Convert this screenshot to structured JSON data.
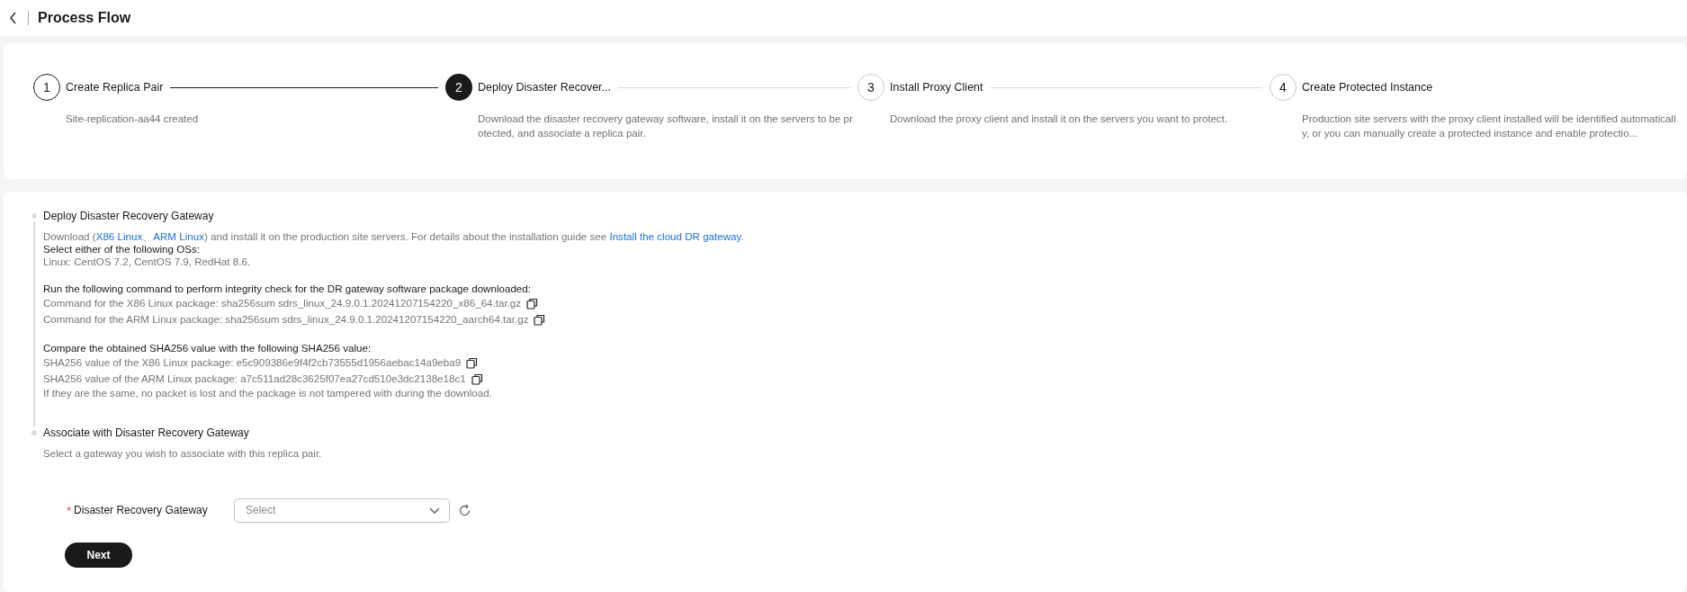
{
  "header": {
    "title": "Process Flow"
  },
  "steps": [
    {
      "number": "1",
      "title": "Create Replica Pair",
      "description": "Site-replication-aa44 created",
      "completed": true,
      "current": false
    },
    {
      "number": "2",
      "title": "Deploy Disaster Recover...",
      "description": "Download the disaster recovery gateway software, install it on the servers to be protected, and associate a replica pair.",
      "completed": false,
      "current": true
    },
    {
      "number": "3",
      "title": "Install Proxy Client",
      "description": "Download the proxy client and install it on the servers you want to protect.",
      "completed": false,
      "current": false
    },
    {
      "number": "4",
      "title": "Create Protected Instance",
      "description": "Production site servers with the proxy client installed will be identified automatically, or you can manually create a protected instance and enable protectio...",
      "completed": false,
      "current": false
    }
  ],
  "sections": [
    {
      "title": "Deploy Disaster Recovery Gateway",
      "groups": [
        [
          {
            "kind": "segments",
            "segments": [
              {
                "text": "Download (",
                "link": false
              },
              {
                "text": "X86 Linux",
                "link": true
              },
              {
                "text": "、",
                "link": false
              },
              {
                "text": "ARM Linux",
                "link": true
              },
              {
                "text": ") and install it on the production site servers. For details about the installation guide see ",
                "link": false
              },
              {
                "text": "Install the cloud DR gateway",
                "link": true
              },
              {
                "text": ".",
                "link": false
              }
            ]
          },
          {
            "kind": "label",
            "text": "Select either of the following OSs:"
          },
          {
            "kind": "note",
            "text": "Linux: CentOS 7.2, CentOS 7.9, RedHat 8.6."
          }
        ],
        [
          {
            "kind": "label",
            "text": "Run the following command to perform integrity check for the DR gateway software package downloaded:"
          },
          {
            "kind": "copy",
            "text": "Command for the X86 Linux package: sha256sum sdrs_linux_24.9.0.1.20241207154220_x86_64.tar.gz"
          },
          {
            "kind": "copy",
            "text": "Command for the ARM Linux package: sha256sum sdrs_linux_24.9.0.1.20241207154220_aarch64.tar.gz"
          }
        ],
        [
          {
            "kind": "label",
            "text": "Compare the obtained SHA256 value with the following SHA256 value:"
          },
          {
            "kind": "copy",
            "text": "SHA256 value of the X86 Linux package:  e5c909386e9f4f2cb73555d1956aebac14a9eba9"
          },
          {
            "kind": "copy",
            "text": "SHA256 value of the ARM Linux package:  a7c511ad28c3625f07ea27cd510e3dc2138e18c1"
          },
          {
            "kind": "note",
            "text": "If they are the same, no packet is lost and the package is not tampered with during the download."
          }
        ]
      ]
    },
    {
      "title": "Associate with Disaster Recovery Gateway",
      "groups": [
        [
          {
            "kind": "note",
            "text": "Select a gateway you wish to associate with this replica pair."
          }
        ]
      ]
    }
  ],
  "form": {
    "required_mark": "*",
    "label": "Disaster Recovery Gateway",
    "placeholder": "Select",
    "required": true
  },
  "next_button": "Next"
}
